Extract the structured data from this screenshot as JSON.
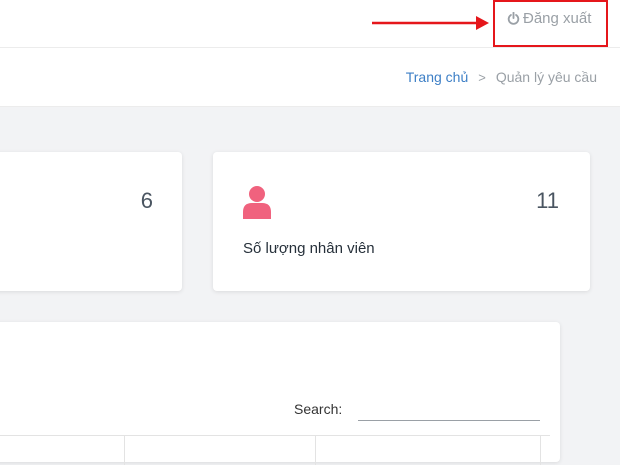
{
  "header": {
    "logout_label": "Đăng xuất",
    "logout_icon": "power-icon",
    "accent": "#e5161b"
  },
  "breadcrumb": {
    "home": "Trang chủ",
    "separator": ">",
    "current": "Quản lý yêu cầu"
  },
  "stats": [
    {
      "count": "6"
    },
    {
      "count": "11",
      "label": "Số lượng nhân viên",
      "icon": "user-icon",
      "icon_color": "#f0627e"
    }
  ],
  "table": {
    "search_label": "Search:",
    "search_value": ""
  }
}
